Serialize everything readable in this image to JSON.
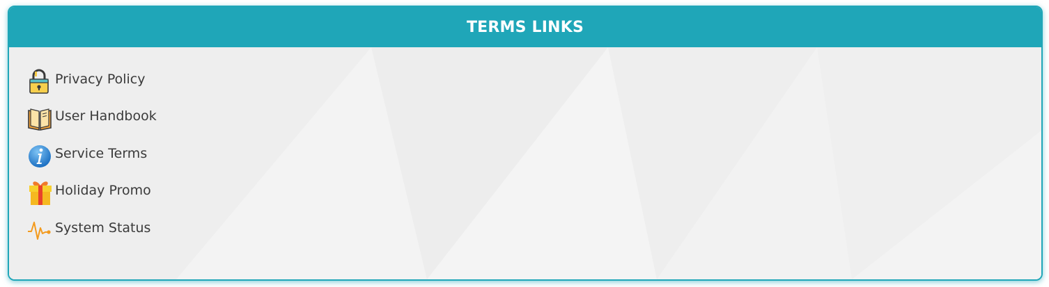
{
  "panel": {
    "title": "TERMS LINKS"
  },
  "links": [
    {
      "label": "Privacy Policy",
      "icon": "lock-icon"
    },
    {
      "label": "User Handbook",
      "icon": "book-icon"
    },
    {
      "label": "Service Terms",
      "icon": "info-icon"
    },
    {
      "label": "Holiday Promo",
      "icon": "gift-icon"
    },
    {
      "label": "System Status",
      "icon": "pulse-icon"
    }
  ],
  "colors": {
    "accent": "#1fa6b8",
    "body_background": "#f0f0f0",
    "header_text": "#ffffff",
    "link_text": "#3a3a3a"
  }
}
